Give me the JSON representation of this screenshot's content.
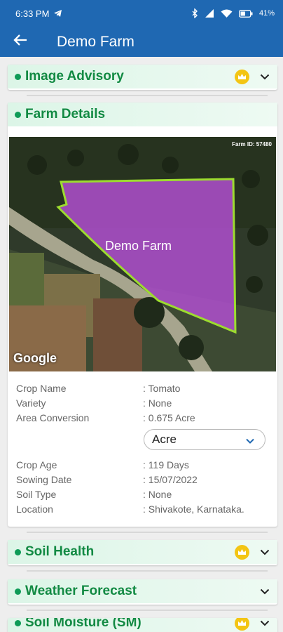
{
  "status_bar": {
    "time": "6:33 PM",
    "battery": "41%"
  },
  "app_bar": {
    "title": "Demo Farm"
  },
  "sections": {
    "image_advisory": "Image Advisory",
    "farm_details": "Farm Details",
    "soil_health": "Soil Health",
    "weather_forecast": "Weather Forecast",
    "soil_moisture": "Soil Moisture (SM)"
  },
  "map": {
    "farm_id": "Farm ID: 57480",
    "farm_label": "Demo Farm",
    "provider": "Google"
  },
  "details": [
    {
      "label": "Crop Name",
      "value": ": Tomato"
    },
    {
      "label": "Variety",
      "value": ": None"
    },
    {
      "label": "Area Conversion",
      "value": ": 0.675 Acre"
    },
    {
      "label": "Crop Age",
      "value": ": 119 Days"
    },
    {
      "label": "Sowing Date",
      "value": ": 15/07/2022"
    },
    {
      "label": "Soil Type",
      "value": ": None"
    },
    {
      "label": "Location",
      "value": ": Shivakote, Karnataka."
    }
  ],
  "unit_select": {
    "selected": "Acre"
  },
  "colors": {
    "primary": "#1f68b2",
    "accent_green": "#128a43",
    "section_bg": "#dcf5e7",
    "premium_gold": "#f3c514",
    "farm_polygon": "#b44fd6"
  }
}
